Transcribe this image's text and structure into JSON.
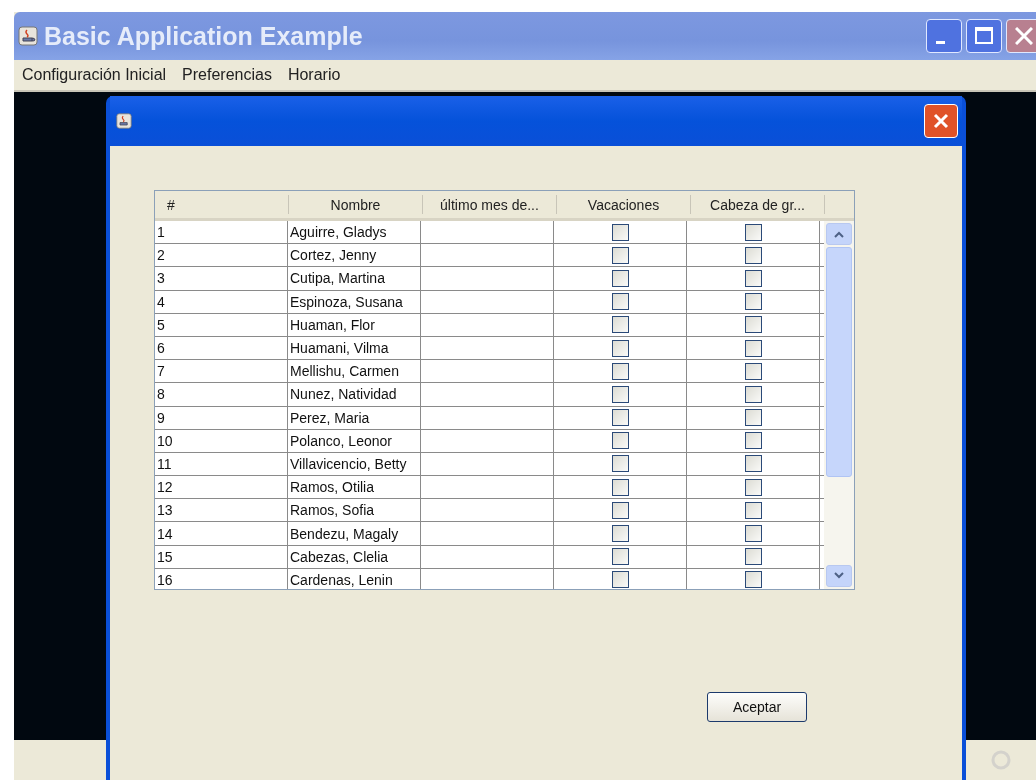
{
  "window": {
    "title": "Basic Application Example"
  },
  "menu": [
    "Configuración Inicial",
    "Preferencias",
    "Horario"
  ],
  "dialog": {
    "table": {
      "columns": [
        "#",
        "Nombre",
        "último mes de...",
        "Vacaciones",
        "Cabeza de gr..."
      ],
      "rows": [
        {
          "num": "1",
          "nombre": "Aguirre, Gladys",
          "vacaciones": false,
          "cabeza": false
        },
        {
          "num": "2",
          "nombre": "Cortez, Jenny",
          "vacaciones": false,
          "cabeza": false
        },
        {
          "num": "3",
          "nombre": "Cutipa, Martina",
          "vacaciones": false,
          "cabeza": false
        },
        {
          "num": "4",
          "nombre": "Espinoza, Susana",
          "vacaciones": false,
          "cabeza": false
        },
        {
          "num": "5",
          "nombre": "Huaman, Flor",
          "vacaciones": false,
          "cabeza": false
        },
        {
          "num": "6",
          "nombre": "Huamani, Vilma",
          "vacaciones": false,
          "cabeza": false
        },
        {
          "num": "7",
          "nombre": "Mellishu, Carmen",
          "vacaciones": false,
          "cabeza": false
        },
        {
          "num": "8",
          "nombre": "Nunez, Natividad",
          "vacaciones": false,
          "cabeza": false
        },
        {
          "num": "9",
          "nombre": "Perez, Maria",
          "vacaciones": false,
          "cabeza": false
        },
        {
          "num": "10",
          "nombre": "Polanco, Leonor",
          "vacaciones": false,
          "cabeza": false
        },
        {
          "num": "11",
          "nombre": "Villavicencio, Betty",
          "vacaciones": false,
          "cabeza": false
        },
        {
          "num": "12",
          "nombre": "Ramos, Otilia",
          "vacaciones": false,
          "cabeza": false
        },
        {
          "num": "13",
          "nombre": "Ramos, Sofia",
          "vacaciones": false,
          "cabeza": false
        },
        {
          "num": "14",
          "nombre": "Bendezu, Magaly",
          "vacaciones": false,
          "cabeza": false
        },
        {
          "num": "15",
          "nombre": "Cabezas, Clelia",
          "vacaciones": false,
          "cabeza": false
        },
        {
          "num": "16",
          "nombre": "Cardenas, Lenin",
          "vacaciones": false,
          "cabeza": false
        }
      ]
    },
    "button": "Aceptar"
  }
}
